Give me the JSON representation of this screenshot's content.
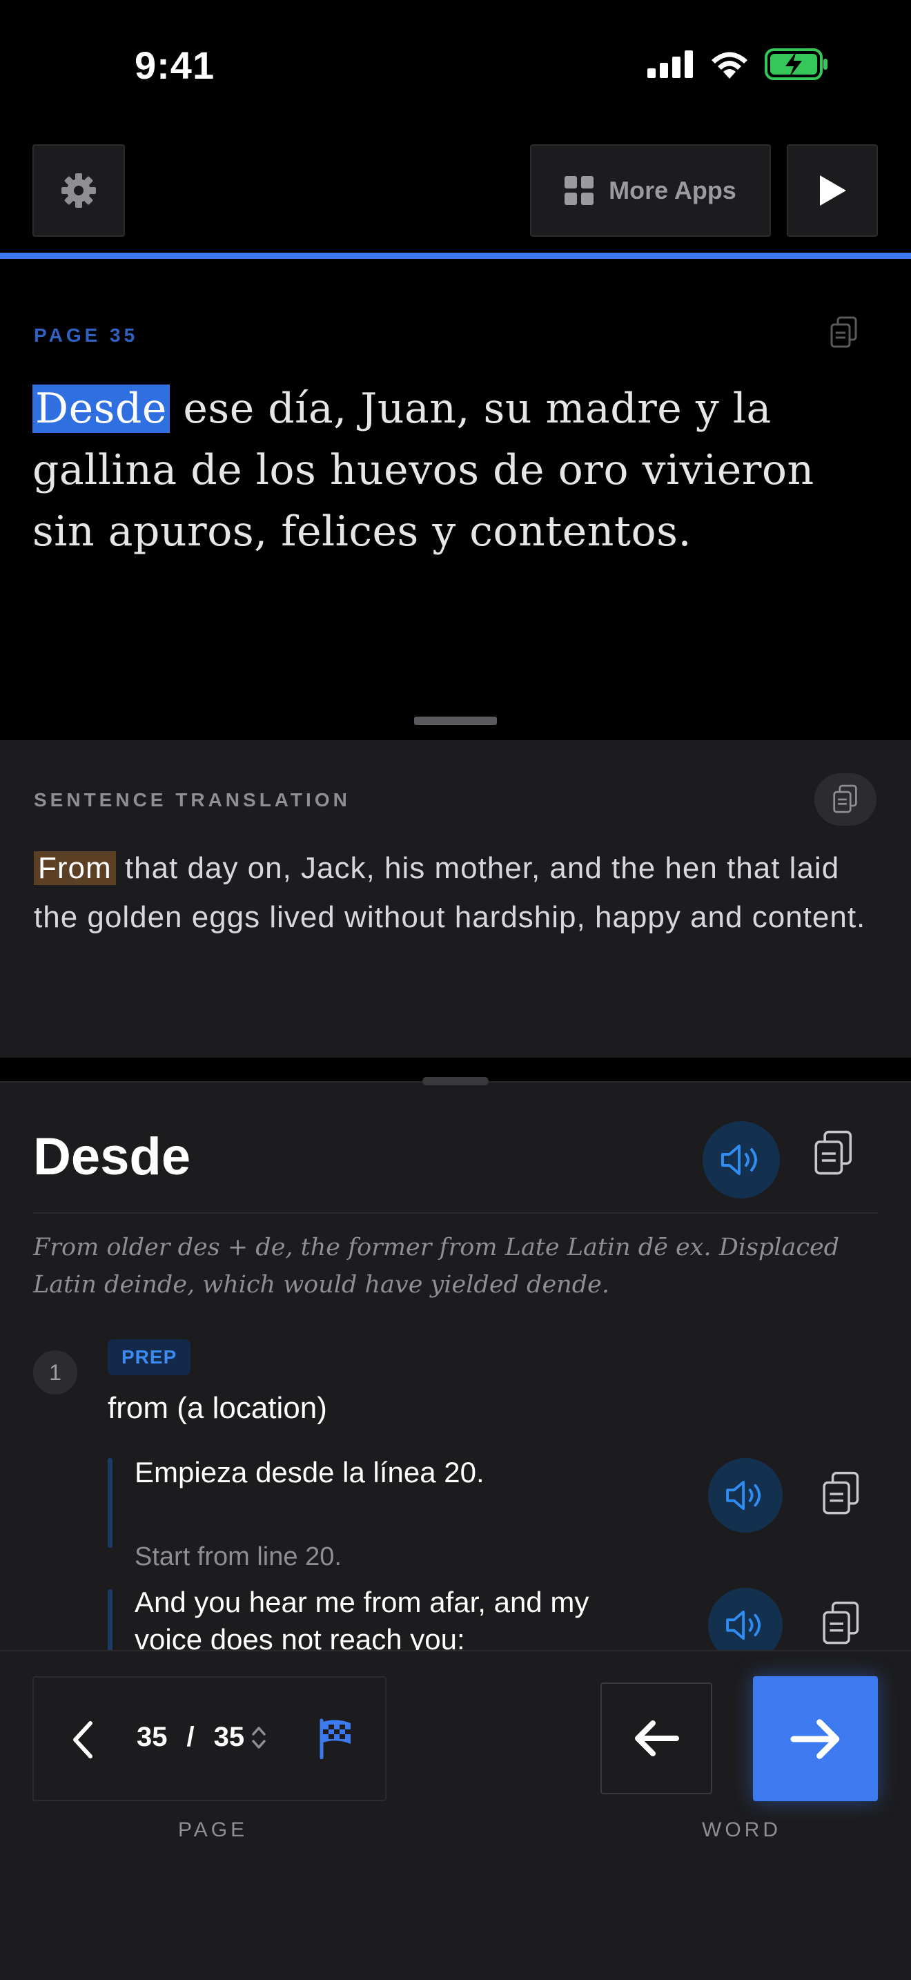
{
  "status": {
    "time": "9:41"
  },
  "toolbar": {
    "more_apps_label": "More Apps"
  },
  "reader": {
    "page_label": "PAGE 35",
    "highlighted_word": "Desde",
    "source_rest": " ese día, Juan, su madre y la gallina de los huevos de oro vivieron sin apuros, felices y contentos."
  },
  "translation": {
    "label": "SENTENCE TRANSLATION",
    "highlighted_word": "From",
    "rest": " that day on, Jack, his mother, and the hen that laid the golden eggs lived without hardship, happy and content."
  },
  "dictionary": {
    "word": "Desde",
    "etymology": "From older des + de, the former from Late Latin dē ex. Displaced Latin deinde, which would have yielded dende.",
    "senses": [
      {
        "number": "1",
        "pos": "PREP",
        "gloss": "from (a location)",
        "examples": [
          {
            "text": "Empieza desde la línea 20.",
            "translation": "Start from line 20."
          },
          {
            "text": "And you hear me from afar, and my voice does not reach you:"
          }
        ]
      }
    ]
  },
  "pager": {
    "current": "35",
    "separator": "/",
    "total": "35",
    "page_caption": "PAGE",
    "word_caption": "WORD"
  },
  "colors": {
    "accent": "#3d7af0",
    "highlight_source": "#2f6fe0",
    "highlight_translation": "#5b4025"
  }
}
